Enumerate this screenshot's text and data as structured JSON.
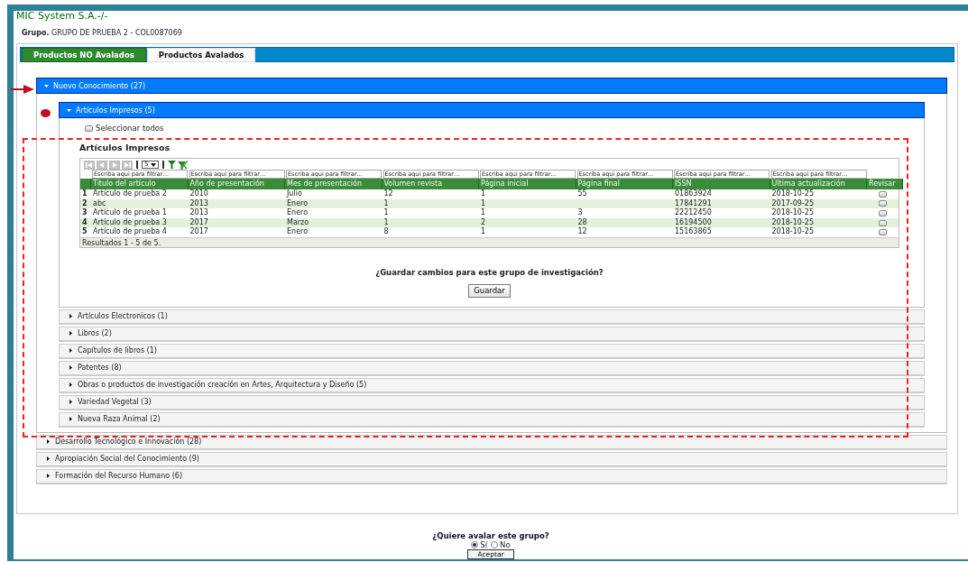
{
  "header": {
    "title": "MIC System S.A.-/-",
    "group_label": "Grupo.",
    "group_value": "GRUPO DE PRUEBA 2 - COL0087069"
  },
  "tabs": [
    {
      "label": "Productos NO Avalados",
      "selected": false
    },
    {
      "label": "Productos Avalados",
      "selected": true
    }
  ],
  "sections": [
    {
      "label": "Nuevo Conocimiento (27)",
      "expanded": true,
      "subsections": [
        {
          "label": "Artículos Impresos (5)",
          "expanded": true,
          "select_all": {
            "label": "Seleccionar todos",
            "checked": false
          },
          "grid": {
            "title": "Artículos Impresos",
            "page_size": "5",
            "filter_placeholders": [
              "Escriba aqui para filtrar…",
              "Escriba aqui para filtrar…",
              "Escriba aqui para filtrar…",
              "Escriba aqui para filtrar…",
              "Escriba aqui para filtrar…",
              "Escriba aqui para filtrar…",
              "Escriba aqui para filtrar…",
              "Escriba aqui para filtrar…"
            ],
            "columns": [
              "Titulo del artículo",
              "Año de presentación",
              "Mes de presentación",
              "Volumen revista",
              "Página inicial",
              "Página final",
              "ISSN",
              "Última actualización",
              "Revisar"
            ],
            "rows": [
              {
                "number": "1",
                "cells": [
                  "Artículo de prueba 2",
                  "2010",
                  "Julio",
                  "12",
                  "1",
                  "55",
                  "01863924",
                  "2018-10-25"
                ],
                "checked": false
              },
              {
                "number": "2",
                "cells": [
                  "abc",
                  "2013",
                  "Enero",
                  "1",
                  "1",
                  "",
                  "17841291",
                  "2017-09-25"
                ],
                "checked": false
              },
              {
                "number": "3",
                "cells": [
                  "Artículo de prueba 1",
                  "2013",
                  "Enero",
                  "1",
                  "1",
                  "3",
                  "22212450",
                  "2018-10-25"
                ],
                "checked": false
              },
              {
                "number": "4",
                "cells": [
                  "Artículo de prueba 3",
                  "2017",
                  "Marzo",
                  "1",
                  "2",
                  "28",
                  "16194500",
                  "2018-10-25"
                ],
                "checked": false
              },
              {
                "number": "5",
                "cells": [
                  "Artículo de prueba 4",
                  "2017",
                  "Enero",
                  "8",
                  "1",
                  "12",
                  "15163865",
                  "2018-10-25"
                ],
                "checked": false
              }
            ],
            "footer": "Resultados 1 - 5 de 5."
          },
          "save_prompt": "¿Guardar cambios para este grupo de investigación?",
          "save_button": "Guardar"
        },
        {
          "label": "Artículos Electronicos (1)",
          "expanded": false
        },
        {
          "label": "Libros (2)",
          "expanded": false
        },
        {
          "label": "Capítulos de libros (1)",
          "expanded": false
        },
        {
          "label": "Patentes (8)",
          "expanded": false
        },
        {
          "label": "Obras o productos de investigación creación en Artes, Arquitectura y Diseño (5)",
          "expanded": false
        },
        {
          "label": "Variedad Vegetal (3)",
          "expanded": false
        },
        {
          "label": "Nueva Raza Animal (2)",
          "expanded": false
        }
      ]
    },
    {
      "label": "Desarrollo Tecnológico e Innovación (28)",
      "expanded": false
    },
    {
      "label": "Apropiación Social del Conocimiento (9)",
      "expanded": false
    },
    {
      "label": "Formación del Recurso Humano (6)",
      "expanded": false
    }
  ],
  "confirm": {
    "question": "¿Quiere avalar este grupo?",
    "options": [
      {
        "label": "Sí",
        "selected": true
      },
      {
        "label": "No",
        "selected": false
      }
    ],
    "button": "Aceptar"
  }
}
